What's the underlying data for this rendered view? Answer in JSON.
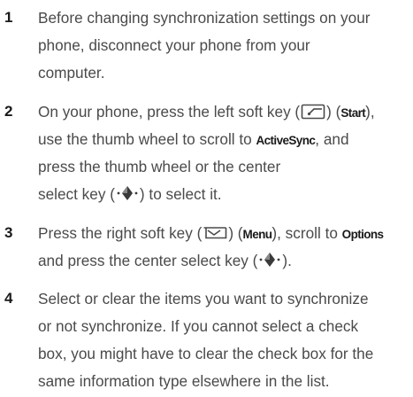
{
  "steps": [
    {
      "number": "1",
      "line1": "Before changing synchronization settings on your",
      "line2": "phone, disconnect your phone from your",
      "line3": "computer."
    },
    {
      "number": "2",
      "l1_pre": "On your phone, press the left soft key (",
      "l1_mid": ") (",
      "l1_kw": "Start",
      "l1_post": "),",
      "l2_pre": "use the thumb wheel to scroll to ",
      "l2_kw": "ActiveSync",
      "l2_post": ", and",
      "line3": "press the thumb wheel or the center",
      "l4_pre": "select key (",
      "l4_post": ") to select it.",
      "icon_left_soft_key": "left-soft-key-icon",
      "icon_select_key": "center-select-key-icon"
    },
    {
      "number": "3",
      "l1_pre": "Press the right soft key (",
      "l1_mid": ") (",
      "l1_kw1": "Menu",
      "l1_mid2": "), scroll to ",
      "l1_kw2": "Options",
      "l2_pre": "and press the center select key (",
      "l2_post": ").",
      "icon_right_soft_key": "right-soft-key-icon",
      "icon_select_key": "center-select-key-icon"
    },
    {
      "number": "4",
      "line1": "Select or clear the items you want to synchronize",
      "line2": "or not synchronize. If you cannot select a check",
      "line3": "box, you might have to clear the check box for the",
      "line4": "same information type elsewhere in the list."
    }
  ]
}
